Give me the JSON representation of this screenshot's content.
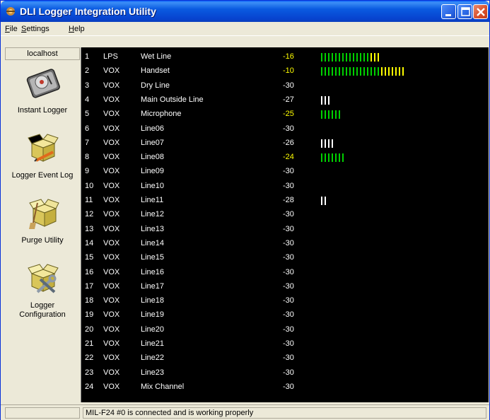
{
  "window": {
    "title": "DLI Logger Integration Utility",
    "icon": "app-icon"
  },
  "menu": [
    {
      "label": "File",
      "mnemonic": "F",
      "rest": "ile"
    },
    {
      "label": "Settings",
      "mnemonic": "S",
      "rest": "ettings"
    },
    {
      "label": "Help",
      "mnemonic": "H",
      "rest": "elp"
    }
  ],
  "sidebar": {
    "host": "localhost",
    "tools": [
      {
        "label": "Instant Logger",
        "icon": "hard-drive-icon"
      },
      {
        "label": "Logger Event Log",
        "icon": "box-pencil-icon"
      },
      {
        "label": "Purge Utility",
        "icon": "box-broom-icon"
      },
      {
        "label": "Logger Configuration",
        "label_line1": "Logger",
        "label_line2": "Configuration",
        "icon": "box-tools-icon"
      }
    ]
  },
  "colors": {
    "meter_green": "#00d000",
    "meter_yellow": "#ffff00",
    "meter_white": "#ffffff",
    "level_hot": "#ffff00"
  },
  "channels": [
    {
      "num": "1",
      "type": "LPS",
      "name": "Wet Line",
      "level": "-16",
      "hot": true,
      "bars": {
        "green": 0,
        "yellow": 0,
        "white": 0
      },
      "meter": [
        {
          "c": "g",
          "n": 14
        },
        {
          "c": "y",
          "n": 3
        }
      ]
    },
    {
      "num": "2",
      "type": "VOX",
      "name": "Handset",
      "level": "-10",
      "hot": true,
      "meter": [
        {
          "c": "g",
          "n": 17
        },
        {
          "c": "y",
          "n": 7
        }
      ]
    },
    {
      "num": "3",
      "type": "VOX",
      "name": "Dry Line",
      "level": "-30",
      "hot": false,
      "meter": []
    },
    {
      "num": "4",
      "type": "VOX",
      "name": "Main Outside Line",
      "level": "-27",
      "hot": false,
      "meter": [
        {
          "c": "w",
          "n": 3
        }
      ]
    },
    {
      "num": "5",
      "type": "VOX",
      "name": "Microphone",
      "level": "-25",
      "hot": true,
      "meter": [
        {
          "c": "g",
          "n": 6
        }
      ]
    },
    {
      "num": "6",
      "type": "VOX",
      "name": "Line06",
      "level": "-30",
      "hot": false,
      "meter": []
    },
    {
      "num": "7",
      "type": "VOX",
      "name": "Line07",
      "level": "-26",
      "hot": false,
      "meter": [
        {
          "c": "w",
          "n": 4
        }
      ]
    },
    {
      "num": "8",
      "type": "VOX",
      "name": "Line08",
      "level": "-24",
      "hot": true,
      "meter": [
        {
          "c": "g",
          "n": 7
        }
      ]
    },
    {
      "num": "9",
      "type": "VOX",
      "name": "Line09",
      "level": "-30",
      "hot": false,
      "meter": []
    },
    {
      "num": "10",
      "type": "VOX",
      "name": "Line10",
      "level": "-30",
      "hot": false,
      "meter": []
    },
    {
      "num": "11",
      "type": "VOX",
      "name": "Line11",
      "level": "-28",
      "hot": false,
      "meter": [
        {
          "c": "w",
          "n": 2
        }
      ]
    },
    {
      "num": "12",
      "type": "VOX",
      "name": "Line12",
      "level": "-30",
      "hot": false,
      "meter": []
    },
    {
      "num": "13",
      "type": "VOX",
      "name": "Line13",
      "level": "-30",
      "hot": false,
      "meter": []
    },
    {
      "num": "14",
      "type": "VOX",
      "name": "Line14",
      "level": "-30",
      "hot": false,
      "meter": []
    },
    {
      "num": "15",
      "type": "VOX",
      "name": "Line15",
      "level": "-30",
      "hot": false,
      "meter": []
    },
    {
      "num": "16",
      "type": "VOX",
      "name": "Line16",
      "level": "-30",
      "hot": false,
      "meter": []
    },
    {
      "num": "17",
      "type": "VOX",
      "name": "Line17",
      "level": "-30",
      "hot": false,
      "meter": []
    },
    {
      "num": "18",
      "type": "VOX",
      "name": "Line18",
      "level": "-30",
      "hot": false,
      "meter": []
    },
    {
      "num": "19",
      "type": "VOX",
      "name": "Line19",
      "level": "-30",
      "hot": false,
      "meter": []
    },
    {
      "num": "20",
      "type": "VOX",
      "name": "Line20",
      "level": "-30",
      "hot": false,
      "meter": []
    },
    {
      "num": "21",
      "type": "VOX",
      "name": "Line21",
      "level": "-30",
      "hot": false,
      "meter": []
    },
    {
      "num": "22",
      "type": "VOX",
      "name": "Line22",
      "level": "-30",
      "hot": false,
      "meter": []
    },
    {
      "num": "23",
      "type": "VOX",
      "name": "Line23",
      "level": "-30",
      "hot": false,
      "meter": []
    },
    {
      "num": "24",
      "type": "VOX",
      "name": "Mix Channel",
      "level": "-30",
      "hot": false,
      "meter": []
    }
  ],
  "status": {
    "message": "MIL-F24 #0 is connected and is working properly"
  }
}
